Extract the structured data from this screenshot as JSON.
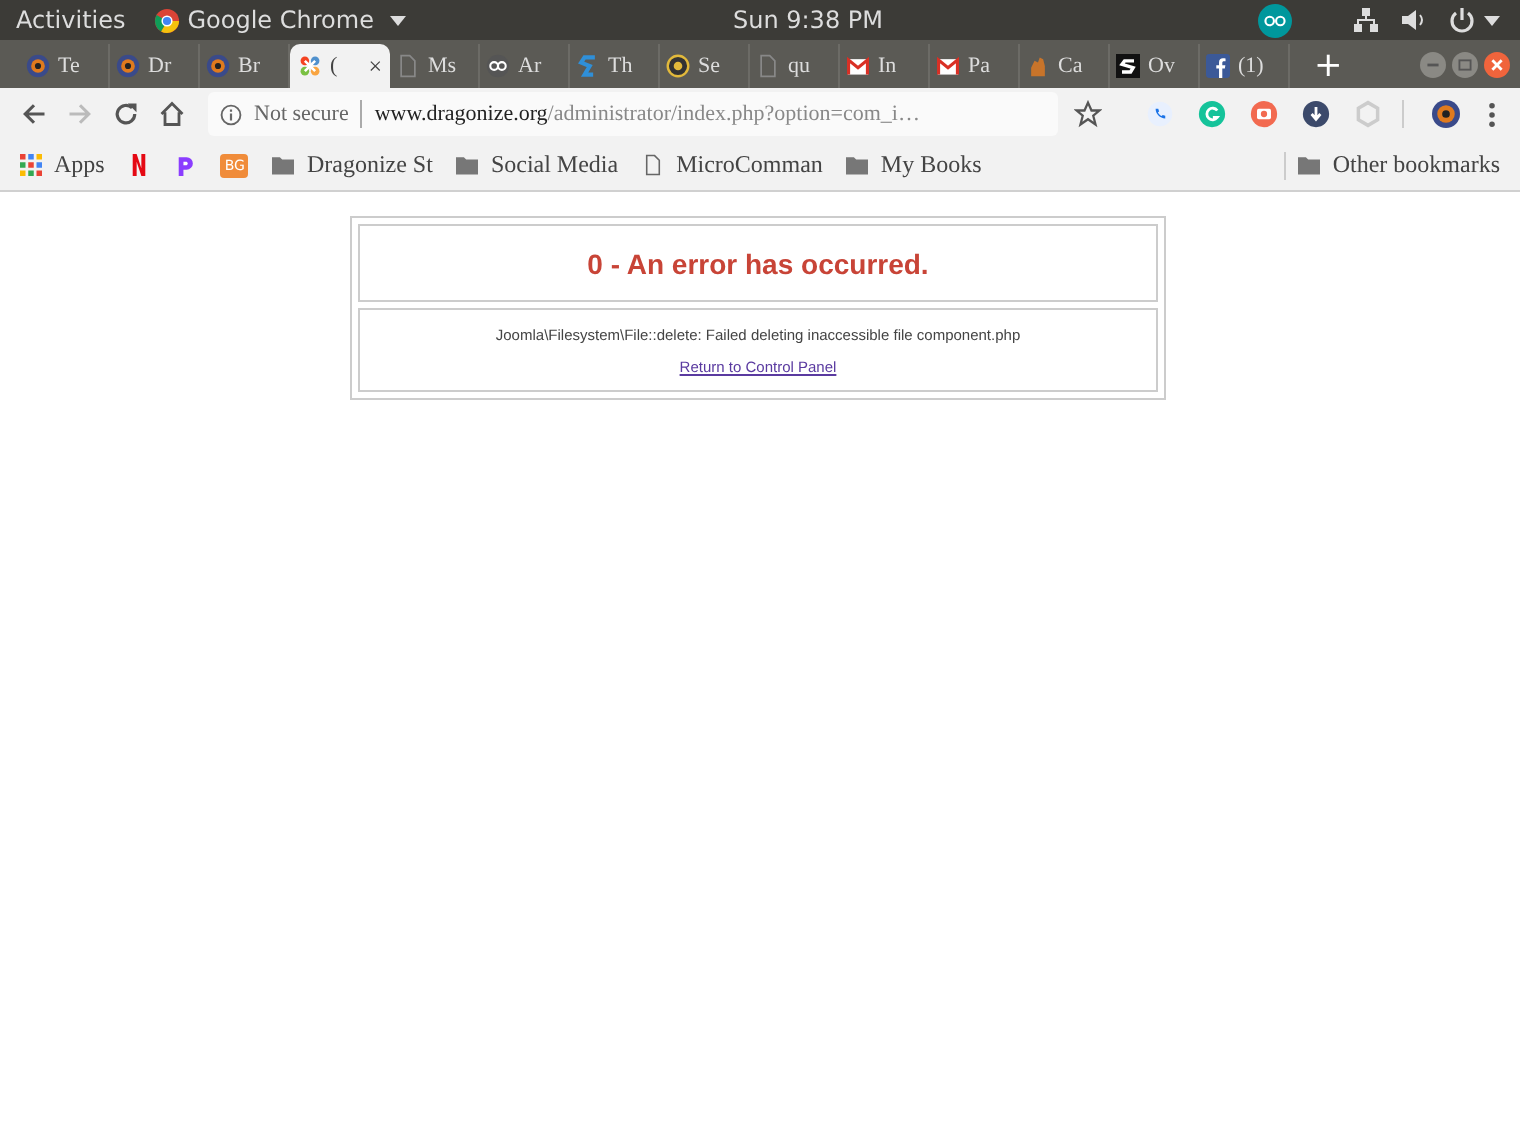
{
  "top_bar": {
    "activities": "Activities",
    "app_name": "Google Chrome",
    "clock": "Sun  9:38 PM"
  },
  "tabs": [
    {
      "label": "Te",
      "kind": "eye",
      "selected": false
    },
    {
      "label": "Dr",
      "kind": "eye",
      "selected": false
    },
    {
      "label": "Br",
      "kind": "eye",
      "selected": false
    },
    {
      "label": "(",
      "kind": "joomla",
      "selected": true,
      "close": "×"
    },
    {
      "label": "Ms",
      "kind": "page",
      "selected": false
    },
    {
      "label": "Ar",
      "kind": "infinity",
      "selected": false
    },
    {
      "label": "Th",
      "kind": "sblue",
      "selected": false
    },
    {
      "label": "Se",
      "kind": "coin",
      "selected": false
    },
    {
      "label": "qu",
      "kind": "page",
      "selected": false
    },
    {
      "label": "In",
      "kind": "mail",
      "selected": false
    },
    {
      "label": "Pa",
      "kind": "mail",
      "selected": false
    },
    {
      "label": "Ca",
      "kind": "hand",
      "selected": false
    },
    {
      "label": "Ov",
      "kind": "sblack",
      "selected": false
    },
    {
      "label": "(1)",
      "kind": "facebook",
      "selected": false
    }
  ],
  "new_tab": "+",
  "omnibox": {
    "security": "Not secure",
    "host": "www.dragonize.org",
    "path": "/administrator/index.php?option=com_i…"
  },
  "bookmarks": [
    {
      "kind": "apps",
      "label": "Apps"
    },
    {
      "kind": "netflix"
    },
    {
      "kind": "p"
    },
    {
      "kind": "badge",
      "label": "BG"
    },
    {
      "kind": "folder",
      "label": "Dragonize St"
    },
    {
      "kind": "folder",
      "label": "Social Media"
    },
    {
      "kind": "page",
      "label": "MicroComman"
    },
    {
      "kind": "folder",
      "label": "My Books"
    }
  ],
  "other_bookmarks": "Other bookmarks",
  "error": {
    "title": "0 - An error has occurred.",
    "message": "Joomla\\Filesystem\\File::delete: Failed deleting inaccessible file component.php",
    "link": "Return to Control Panel"
  }
}
